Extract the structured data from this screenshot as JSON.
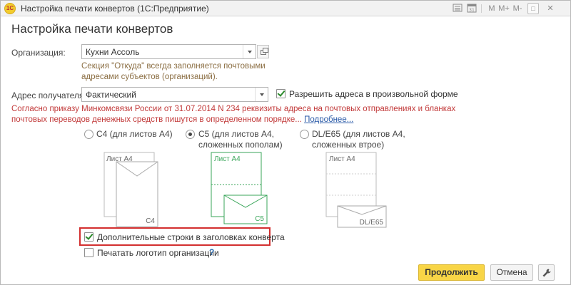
{
  "window": {
    "title": "Настройка печати конвертов  (1С:Предприятие)",
    "logo_text": "1С",
    "controls": [
      "menu-icon",
      "calendar-icon",
      "m-icon",
      "m-plus-icon",
      "m-minus-icon",
      "maximize-icon",
      "close-icon"
    ],
    "control_glyphs": {
      "m": "M",
      "m_plus": "M+",
      "m_minus": "M-",
      "maximize": "□",
      "close": "✕"
    }
  },
  "form": {
    "title": "Настройка печати конвертов",
    "organization": {
      "label": "Организация:",
      "value": "Кухни Ассоль"
    },
    "hint": "Секция \"Откуда\" всегда заполняется почтовыми адресами субъектов (организаций).",
    "recipient_address": {
      "label": "Адрес получателя:",
      "value": "Фактический"
    },
    "allow_free_form": {
      "label": "Разрешить адреса в произвольной форме",
      "checked": true
    },
    "warning": {
      "text": "Согласно приказу Минкомсвязи России от 31.07.2014 N 234 реквизиты адреса на почтовых отправлениях и бланках почтовых переводов денежных средств пишутся в определенном порядке...",
      "link": "Подробнее..."
    },
    "formats": [
      {
        "label": "С4 (для листов А4)",
        "selected": false,
        "sheet": "Лист А4",
        "env": "С4"
      },
      {
        "label": "С5 (для листов А4, сложенных пополам)",
        "selected": true,
        "sheet": "Лист А4",
        "env": "С5"
      },
      {
        "label": "DL/Е65 (для листов А4, сложенных втрое)",
        "selected": false,
        "sheet": "Лист А4",
        "env": "DL/Е65"
      }
    ],
    "extra_lines": {
      "label": "Дополнительные строки в заголовках конверта",
      "checked": true
    },
    "print_logo": {
      "label": "Печатать логотип организации",
      "checked": false
    },
    "help_mark": "?",
    "buttons": {
      "continue": "Продолжить",
      "cancel": "Отмена"
    },
    "colors": {
      "accent": "#f8d546",
      "selected_envelope": "#3aa65a",
      "warning": "#c23a3a",
      "hint": "#8b6e43",
      "highlight": "#d32f2f"
    }
  }
}
